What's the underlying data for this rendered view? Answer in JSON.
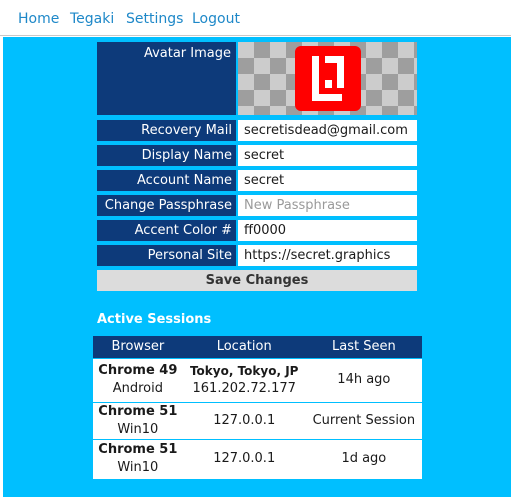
{
  "nav": {
    "links": [
      "Home",
      "Tegaki",
      "Settings",
      "Logout"
    ]
  },
  "colors": {
    "accent": "#ff0000",
    "background": "#00bfff",
    "label_bg": "#0d3a7a"
  },
  "settings": {
    "avatar_label": "Avatar Image",
    "rows": [
      {
        "label": "Recovery Mail",
        "value": "secretisdead@gmail.com",
        "placeholder": ""
      },
      {
        "label": "Display Name",
        "value": "secret",
        "placeholder": ""
      },
      {
        "label": "Account Name",
        "value": "secret",
        "placeholder": ""
      },
      {
        "label": "Change Passphrase",
        "value": "",
        "placeholder": "New Passphrase"
      },
      {
        "label": "Accent Color #",
        "value": "ff0000",
        "placeholder": ""
      },
      {
        "label": "Personal Site",
        "value": "https://secret.graphics",
        "placeholder": ""
      }
    ],
    "save_label": "Save Changes"
  },
  "sessions": {
    "title": "Active Sessions",
    "headers": [
      "Browser",
      "Location",
      "Last Seen"
    ],
    "rows": [
      {
        "browser": "Chrome 49",
        "os": "Android",
        "city": "Tokyo, Tokyo, JP",
        "ip": "161.202.72.177",
        "last_seen": "14h ago"
      },
      {
        "browser": "Chrome 51",
        "os": "Win10",
        "city": "",
        "ip": "127.0.0.1",
        "last_seen": "Current Session"
      },
      {
        "browser": "Chrome 51",
        "os": "Win10",
        "city": "",
        "ip": "127.0.0.1",
        "last_seen": "1d ago"
      }
    ]
  }
}
